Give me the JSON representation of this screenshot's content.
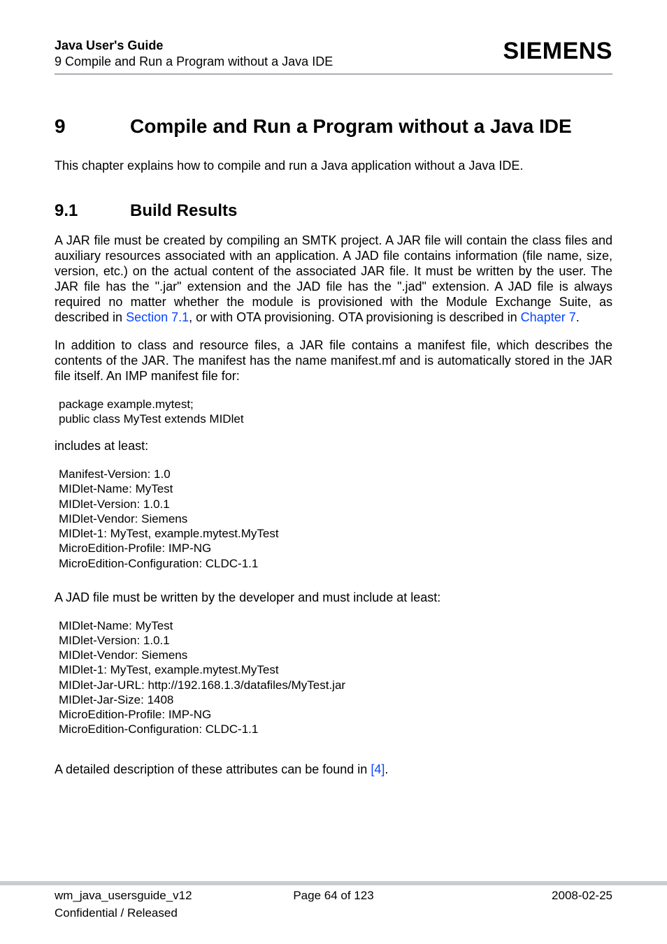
{
  "header": {
    "title": "Java User's Guide",
    "subtitle": "9 Compile and Run a Program without a Java IDE",
    "brand": "SIEMENS"
  },
  "h1": {
    "num": "9",
    "text": "Compile and Run a Program without a Java IDE"
  },
  "intro": "This chapter explains how to compile and run a Java application without a Java IDE.",
  "h2": {
    "num": "9.1",
    "text": "Build Results"
  },
  "p1a": "A JAR file must be created by compiling an SMTK project. A JAR file will contain the class files and auxiliary resources associated with an application. A JAD file contains information (file name, size, version, etc.) on the actual content of the associated JAR file. It must be written by the user. The JAR file has the \".jar\" extension and the JAD file has the \".jad\" extension. A JAD file is always required no matter whether the module is provisioned with the Module Exchange Suite, as described in ",
  "link1": "Section 7.1",
  "p1b": ", or with OTA provisioning. OTA provisioning is described in ",
  "link2": "Chapter 7",
  "p1c": ".",
  "p2": "In addition to class and resource files, a JAR file contains a manifest file, which describes the contents of the JAR. The manifest has the name manifest.mf and is automatically stored in the JAR file itself. An IMP manifest file for:",
  "code1": "package example.mytest;\npublic class MyTest extends MIDlet",
  "p3": "includes at least:",
  "code2": "Manifest-Version: 1.0\nMIDlet-Name: MyTest\nMIDlet-Version: 1.0.1\nMIDlet-Vendor: Siemens\nMIDlet-1: MyTest, example.mytest.MyTest\nMicroEdition-Profile: IMP-NG\nMicroEdition-Configuration: CLDC-1.1",
  "p4": "A JAD file must be written by the developer and must include at least:",
  "code3": "MIDlet-Name: MyTest\nMIDlet-Version: 1.0.1\nMIDlet-Vendor: Siemens\nMIDlet-1: MyTest, example.mytest.MyTest\nMIDlet-Jar-URL: http://192.168.1.3/datafiles/MyTest.jar\nMIDlet-Jar-Size: 1408\nMicroEdition-Profile: IMP-NG\nMicroEdition-Configuration: CLDC-1.1",
  "p5a": "A detailed description of these attributes can be found in ",
  "link3": "[4]",
  "p5b": ".",
  "footer": {
    "left1": "wm_java_usersguide_v12",
    "left2": "Confidential / Released",
    "center": "Page 64 of 123",
    "right": "2008-02-25"
  }
}
